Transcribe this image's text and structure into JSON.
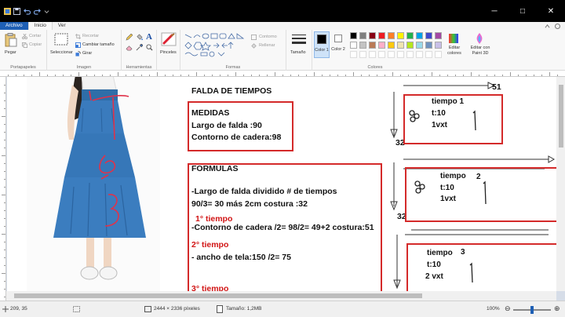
{
  "window": {
    "controls": {
      "minimize": "─",
      "maximize": "□",
      "close": "✕"
    }
  },
  "tabs": [
    {
      "label": "Archivo"
    },
    {
      "label": "Inicio"
    },
    {
      "label": "Ver"
    }
  ],
  "ribbon": {
    "clipboard": {
      "paste": "Pegar",
      "cut": "Cortar",
      "copy": "Copiar",
      "label": "Portapapeles"
    },
    "image": {
      "select": "Seleccionar",
      "crop": "Recortar",
      "resize": "Cambiar tamaño",
      "rotate": "Girar",
      "label": "Imagen"
    },
    "tools": {
      "label": "Herramientas"
    },
    "brushes": {
      "label": "Pinceles"
    },
    "shapes": {
      "outline": "Contorno",
      "fill": "Rellenar",
      "label": "Formas"
    },
    "size": {
      "label": "Tamaño"
    },
    "colors": {
      "color1": "Color 1",
      "color2": "Color 2",
      "edit": "Editar colores",
      "paint3d": "Editar con Paint 3D",
      "label": "Colores",
      "palette": [
        "#000000",
        "#7f7f7f",
        "#880015",
        "#ed1c24",
        "#ff7f27",
        "#fff200",
        "#22b14c",
        "#00a2e8",
        "#3f48cc",
        "#a349a4",
        "#ffffff",
        "#c3c3c3",
        "#b97a57",
        "#ffaec9",
        "#ffc90e",
        "#efe4b0",
        "#b5e61d",
        "#99d9ea",
        "#7092be",
        "#c8bfe7"
      ]
    }
  },
  "document": {
    "title": "FALDA DE TIEMPOS",
    "medidas": {
      "heading": "MEDIDAS",
      "line1": "Largo de falda :90",
      "line2": "Contorno de cadera:98"
    },
    "formulas": {
      "heading": "FORMULAS",
      "line1": "-Largo de falda dividido # de tiempos",
      "line2": "90/3= 30 más 2cm costura :32",
      "tiempo1": "1° tiempo",
      "line3": "-Contorno de cadera /2= 98/2= 49+2 costura:51",
      "tiempo2": "2° tiempo",
      "line4": "- ancho de tela:150 /2= 75",
      "tiempo3": "3° tiempo"
    },
    "diagram": {
      "top_label": "51",
      "left_label1": "32",
      "left_label2": "32",
      "tier1": {
        "name": "tiempo 1",
        "t": "t:10",
        "v": "1vxt"
      },
      "tier2": {
        "name": "tiempo",
        "num": "2",
        "t": "t:10",
        "v": "1vxt"
      },
      "tier3": {
        "name": "tiempo",
        "num": "3",
        "t": "t:10",
        "v": "2 vxt"
      }
    },
    "photo_marks": {
      "m1": "1",
      "m2": "2",
      "m3": "3"
    }
  },
  "status": {
    "cursor": "209, 35",
    "dimensions": "2444 × 2336 píxeles",
    "filesize": "Tamaño: 1,2MB",
    "zoom": "100%",
    "zoom_level": 0.5
  }
}
